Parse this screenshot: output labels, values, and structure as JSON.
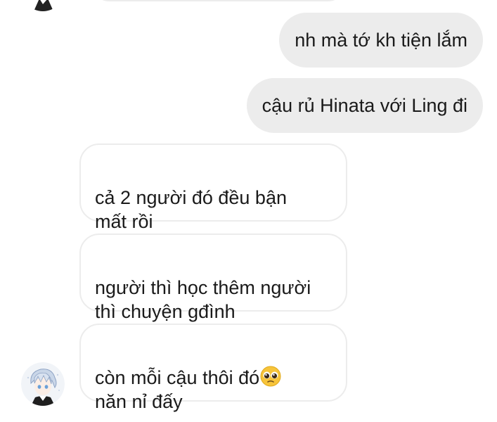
{
  "messages": [
    {
      "direction": "sent",
      "text": "nh mà tớ kh tiện lắm"
    },
    {
      "direction": "sent",
      "text": "cậu rủ Hinata với Ling đi"
    },
    {
      "direction": "received",
      "text": "cả 2 người đó đều bận\nmất rồi"
    },
    {
      "direction": "received",
      "text": "người thì học thêm người\nthì chuyện gđình"
    },
    {
      "direction": "received",
      "text": "còn mỗi cậu thôi đó",
      "text_line2": "năn nỉ đấy",
      "emoji": "pleading-face-emoji"
    }
  ],
  "avatar": {
    "icon": "anime-boy-avatar"
  },
  "colors": {
    "sent_bubble": "#ececec",
    "received_border": "#ececec",
    "text": "#1a1a1a"
  }
}
